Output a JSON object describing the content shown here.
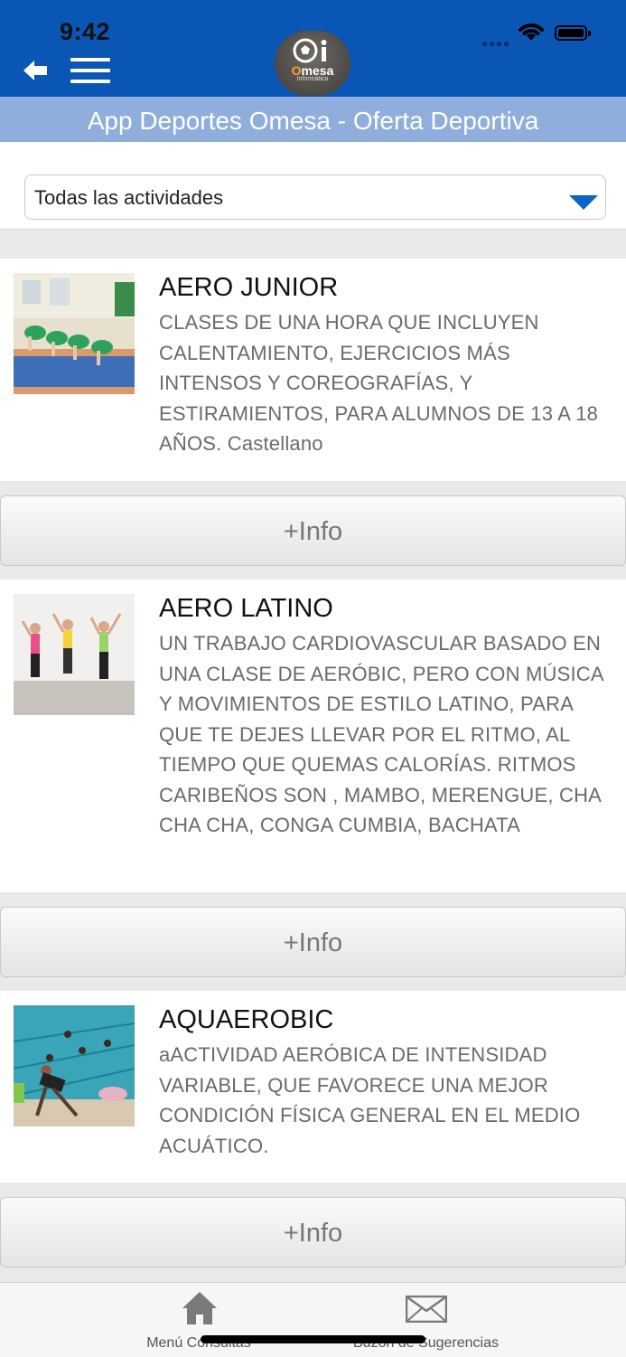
{
  "status": {
    "time": "9:42"
  },
  "header": {
    "logo_text": "Omesa",
    "logo_sub": "Informática",
    "title": "App Deportes Omesa - Oferta Deportiva"
  },
  "filter": {
    "selected": "Todas las actividades"
  },
  "activities": [
    {
      "title": "AERO JUNIOR",
      "description": "CLASES DE UNA HORA QUE INCLUYEN CALENTAMIENTO, EJERCICIOS MÁS INTENSOS Y COREOGRAFÍAS, Y ESTIRAMIENTOS, PARA ALUMNOS DE 13 A 18 AÑOS. Castellano",
      "button": "+Info"
    },
    {
      "title": "AERO LATINO",
      "description": "UN TRABAJO CARDIOVASCULAR BASADO EN UNA CLASE DE AERÓBIC, PERO CON MÚSICA Y MOVIMIENTOS DE ESTILO LATINO, PARA QUE TE DEJES LLEVAR POR EL RITMO, AL TIEMPO QUE QUEMAS CALORÍAS. RITMOS CARIBEÑOS SON , MAMBO, MERENGUE, CHA CHA CHA, CONGA CUMBIA, BACHATA",
      "button": "+Info"
    },
    {
      "title": "AQUAEROBIC",
      "description": "aACTIVIDAD AERÓBICA DE INTENSIDAD VARIABLE, QUE FAVORECE UNA MEJOR CONDICIÓN FÍSICA GENERAL EN EL MEDIO ACUÁTICO.",
      "button": "+Info"
    }
  ],
  "tabbar": {
    "items": [
      {
        "label": "Menú Consultas",
        "icon": "home-icon"
      },
      {
        "label": "Buzón de Sugerencias",
        "icon": "envelope-icon"
      }
    ]
  },
  "colors": {
    "header_blue": "#0a56b4",
    "title_bar": "#8faedb",
    "caret_blue": "#0a66c2"
  }
}
